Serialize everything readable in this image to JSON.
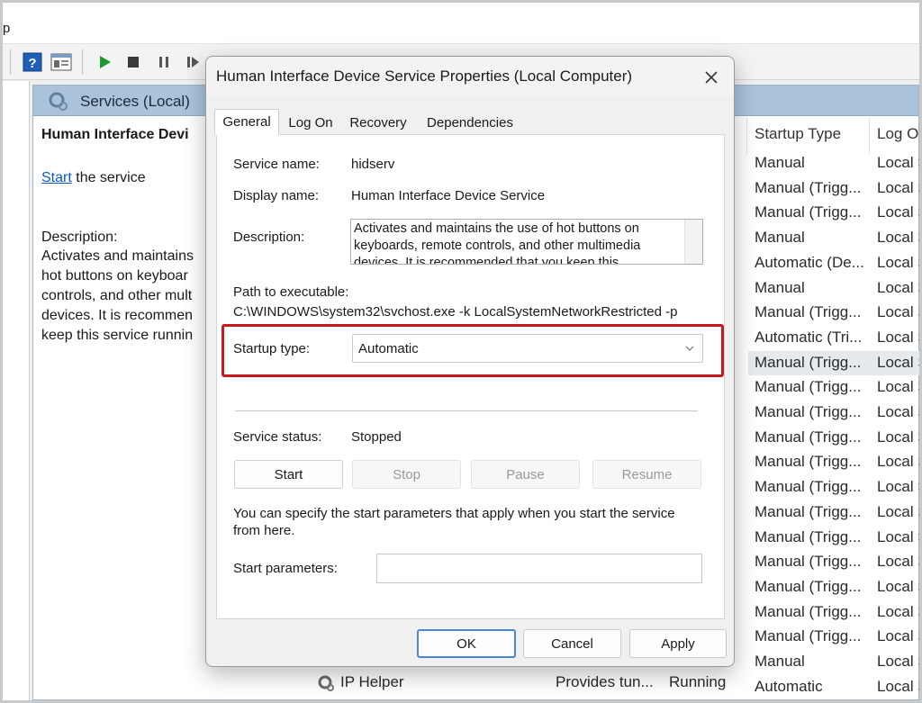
{
  "menubar": {
    "partial_label": "p"
  },
  "panel": {
    "title": "Services (Local)",
    "selected_service": "Human Interface Devi",
    "start_link": "Start",
    "start_suffix": " the service",
    "description_label": "Description:",
    "description_lines": [
      "Activates and maintains",
      "hot buttons on keyboar",
      "controls, and other mult",
      "devices. It is recommen",
      "keep this service runnin"
    ]
  },
  "list": {
    "columns": {
      "startup_type": "Startup Type",
      "log_on": "Log O"
    },
    "rows": [
      {
        "startup": "Manual",
        "logon": "Local S"
      },
      {
        "startup": "Manual (Trigg...",
        "logon": "Local S"
      },
      {
        "startup": "Manual (Trigg...",
        "logon": "Local S"
      },
      {
        "startup": "Manual",
        "logon": "Local S"
      },
      {
        "startup": "Automatic (De...",
        "logon": "Local S"
      },
      {
        "startup": "Manual",
        "logon": "Local S"
      },
      {
        "startup": "Manual (Trigg...",
        "logon": "Local S"
      },
      {
        "startup": "Automatic (Tri...",
        "logon": "Local S"
      },
      {
        "startup": "Manual (Trigg...",
        "logon": "Local S"
      },
      {
        "startup": "Manual (Trigg...",
        "logon": "Local S"
      },
      {
        "startup": "Manual (Trigg...",
        "logon": "Local S"
      },
      {
        "startup": "Manual (Trigg...",
        "logon": "Local S"
      },
      {
        "startup": "Manual (Trigg...",
        "logon": "Local S"
      },
      {
        "startup": "Manual (Trigg...",
        "logon": "Local S"
      },
      {
        "startup": "Manual (Trigg...",
        "logon": "Local S"
      },
      {
        "startup": "Manual (Trigg...",
        "logon": "Local S"
      },
      {
        "startup": "Manual (Trigg...",
        "logon": "Local S"
      },
      {
        "startup": "Manual (Trigg...",
        "logon": "Local S"
      },
      {
        "startup": "Manual (Trigg...",
        "logon": "Local S"
      },
      {
        "startup": "Manual (Trigg...",
        "logon": "Local S"
      },
      {
        "startup": "Manual",
        "logon": "Local S"
      },
      {
        "startup": "Automatic",
        "logon": "Local S"
      }
    ],
    "selected_row": 8,
    "bottom_service": {
      "name": "IP Helper",
      "description": "Provides tun...",
      "status": "Running"
    }
  },
  "dialog": {
    "title": "Human Interface Device Service Properties (Local Computer)",
    "tabs": [
      "General",
      "Log On",
      "Recovery",
      "Dependencies"
    ],
    "active_tab": "General",
    "service_name_label": "Service name:",
    "service_name": "hidserv",
    "display_name_label": "Display name:",
    "display_name": "Human Interface Device Service",
    "description_label": "Description:",
    "description": "Activates and maintains the use of hot buttons on keyboards, remote controls, and other multimedia devices. It is recommended that you keep this",
    "path_label": "Path to executable:",
    "path": "C:\\WINDOWS\\system32\\svchost.exe -k LocalSystemNetworkRestricted -p",
    "startup_type_label": "Startup type:",
    "startup_type": "Automatic",
    "service_status_label": "Service status:",
    "service_status": "Stopped",
    "buttons": {
      "start": "Start",
      "stop": "Stop",
      "pause": "Pause",
      "resume": "Resume"
    },
    "hint": "You can specify the start parameters that apply when you start the service from here.",
    "start_params_label": "Start parameters:",
    "start_params_value": "",
    "footer": {
      "ok": "OK",
      "cancel": "Cancel",
      "apply": "Apply"
    }
  },
  "colors": {
    "highlight": "#c8171e",
    "header": "#aac3db",
    "link": "#0b5bc4"
  }
}
